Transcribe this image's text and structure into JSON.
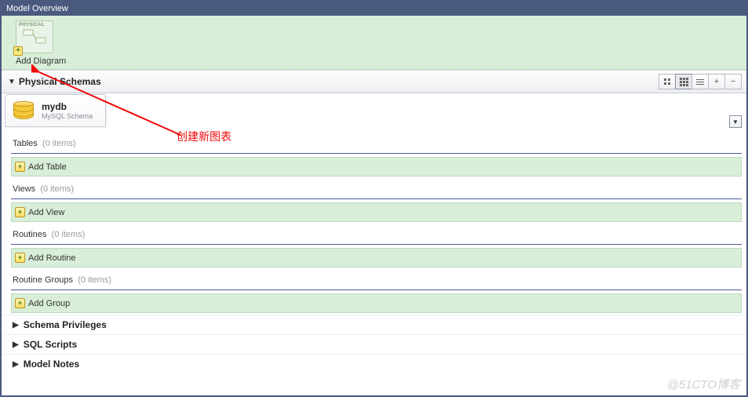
{
  "window": {
    "title": "Model Overview"
  },
  "diagram": {
    "iconLabel": "PHYSICAL",
    "label": "Add Diagram"
  },
  "physicalSchemas": {
    "title": "Physical Schemas"
  },
  "schema": {
    "name": "mydb",
    "subtitle": "MySQL Schema"
  },
  "categories": {
    "tables": {
      "label": "Tables",
      "count": "(0 items)",
      "addLabel": "Add Table"
    },
    "views": {
      "label": "Views",
      "count": "(0 items)",
      "addLabel": "Add View"
    },
    "routines": {
      "label": "Routines",
      "count": "(0 items)",
      "addLabel": "Add Routine"
    },
    "routineGroups": {
      "label": "Routine Groups",
      "count": "(0 items)",
      "addLabel": "Add Group"
    }
  },
  "sections": {
    "privileges": "Schema Privileges",
    "scripts": "SQL Scripts",
    "notes": "Model Notes"
  },
  "annotation": {
    "text": "创建新图表"
  },
  "watermark": "@51CTO博客",
  "icons": {
    "plus": "+",
    "minus": "−",
    "triangleDown": "▼",
    "triangleRight": "▶"
  }
}
